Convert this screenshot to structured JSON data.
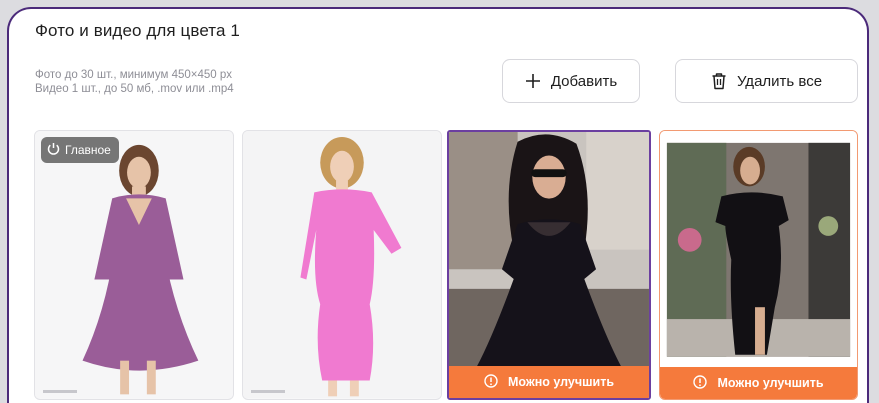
{
  "section": {
    "title": "Фото и видео для цвета 1",
    "hint_line1": "Фото до 30 шт., минимум 450×450 px",
    "hint_line2": "Видео 1 шт., до 50 мб, .mov или .mp4"
  },
  "toolbar": {
    "add_label": "Добавить",
    "delete_all_label": "Удалить все"
  },
  "photos": [
    {
      "badge": "Главное",
      "dress_color": "#9a5d98"
    },
    {
      "dress_color": "#f07ad0"
    },
    {
      "warning": "Можно улучшить",
      "dress_color": "#15121a"
    },
    {
      "warning": "Можно улучшить",
      "dress_color": "#121014"
    }
  ],
  "colors": {
    "accent_border": "#4b2a7a",
    "warning_bar": "#f57a3c",
    "selected_border": "#6b3fa0"
  }
}
